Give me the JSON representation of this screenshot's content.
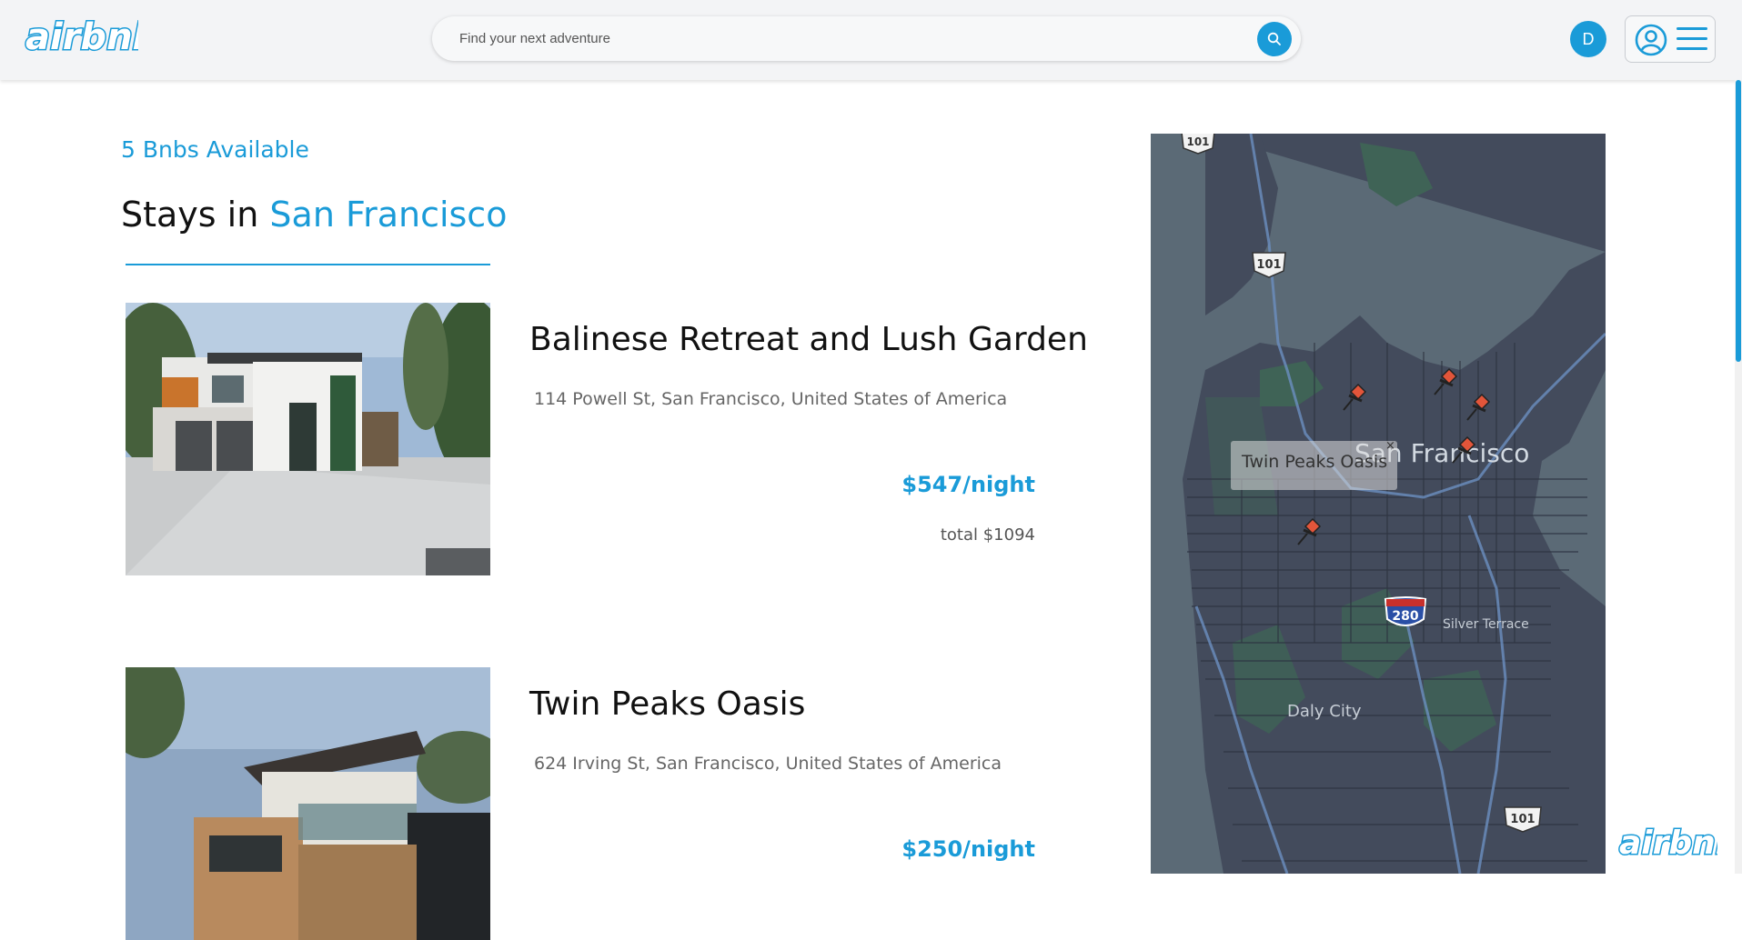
{
  "header": {
    "logo_text": "airbnb",
    "search": {
      "placeholder": "Find your next adventure",
      "value": ""
    },
    "search_icon": "search-icon",
    "avatar_initial": "D",
    "menu_icons": [
      "user-circle-icon",
      "hamburger-menu-icon"
    ]
  },
  "listing_summary": {
    "count_text": "5 Bnbs Available",
    "heading_prefix": "Stays in ",
    "heading_city": "San Francisco"
  },
  "listings": [
    {
      "title": "Balinese Retreat and Lush Garden",
      "address": "114 Powell St, San Francisco, United States of America",
      "price": "$547/night",
      "total": "total $1094"
    },
    {
      "title": "Twin Peaks Oasis",
      "address": "624 Irving St, San Francisco, United States of America",
      "price": "$250/night",
      "total": ""
    }
  ],
  "map": {
    "popup_title": "Twin Peaks Oasis",
    "popup_close": "×",
    "labels": {
      "city": "San Francisco",
      "daly_city": "Daly City",
      "silver_terrace": "Silver Terrace",
      "shield_101_top": "101",
      "shield_101_mid": "101",
      "shield_101_bottom": "101",
      "shield_280": "280"
    },
    "marker_count": 5
  },
  "colors": {
    "accent": "#1a9bd8",
    "header_bg": "#f3f4f6",
    "map_land": "#434b5c",
    "map_water": "#5b6a76",
    "map_park": "#3f6356",
    "marker": "#e2553a"
  },
  "footer": {
    "logo_text": "airbnb"
  }
}
